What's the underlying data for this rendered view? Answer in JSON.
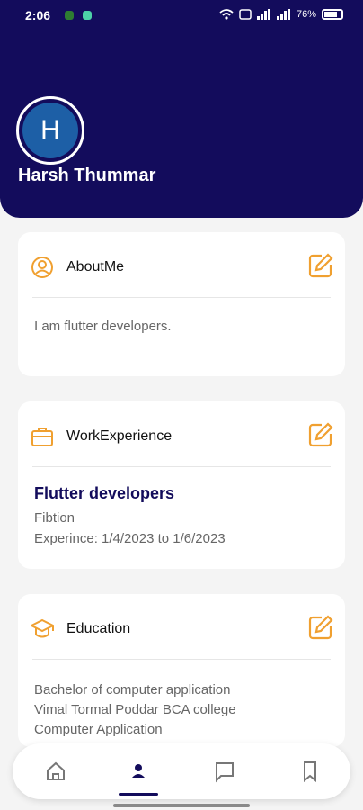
{
  "status_bar": {
    "time": "2:06",
    "battery_text": "76%"
  },
  "profile": {
    "avatar_letter": "H",
    "name": "Harsh Thummar"
  },
  "cards": {
    "about": {
      "title": "AboutMe",
      "text": "I am flutter developers."
    },
    "work": {
      "title": "WorkExperience",
      "role": "Flutter developers",
      "company": "Fibtion",
      "experience": "Experince: 1/4/2023 to 1/6/2023"
    },
    "education": {
      "title": "Education",
      "degree": "Bachelor of computer application",
      "college": "Vimal Tormal Poddar BCA college",
      "field": "Computer Application"
    }
  },
  "nav": {
    "active_tab": "profile",
    "tabs": [
      "home",
      "profile",
      "chat",
      "bookmark"
    ]
  },
  "colors": {
    "primary": "#130c5c",
    "accent": "#f0a030",
    "avatar": "#1d5fa6"
  },
  "icons": [
    "wifi-icon",
    "signal-icon",
    "battery-icon",
    "account-circle-icon",
    "briefcase-icon",
    "school-icon",
    "edit-icon",
    "home-icon",
    "person-icon",
    "chat-icon",
    "bookmark-icon"
  ]
}
